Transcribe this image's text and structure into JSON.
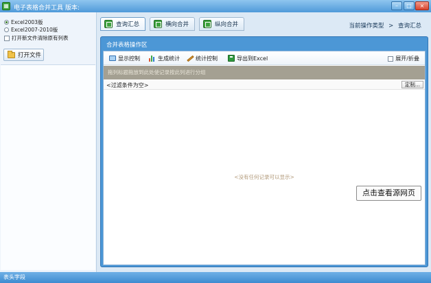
{
  "window": {
    "title": "电子表格合并工具  版本:",
    "minimize_label": "–",
    "maximize_label": "□",
    "close_label": "×"
  },
  "left_panel": {
    "radio_options": [
      {
        "label": "Excel2003版",
        "selected": true
      },
      {
        "label": "Excel2007-2010版",
        "selected": false
      }
    ],
    "clear_checkbox_label": "打开新文件清除原有列表",
    "open_file_label": "打开文件"
  },
  "tabs": [
    {
      "label": "查询汇总",
      "active": true
    },
    {
      "label": "横向合并",
      "active": false
    },
    {
      "label": "纵向合并",
      "active": false
    }
  ],
  "breadcrumb": {
    "prefix": "当前操作类型",
    "separator": ">",
    "current": "查询汇总"
  },
  "main": {
    "panel_title": "合并表格操作区",
    "toolbar": {
      "display_control": "显示控制",
      "generate_stats": "生成统计",
      "stats_control": "统计控制",
      "export_excel": "导出到Excel",
      "expand_collapse": "展开/折叠"
    },
    "group_hint": "拖列标题拖放到此处使记录按此列进行分组",
    "filter_text": "<过滤条件为空>",
    "custom_button": "定制...",
    "empty_message": "<没有任何记录可以显示>"
  },
  "overlay_button": "点击查看源网页",
  "status_bar": "表头字段",
  "colors": {
    "title_bar": "#4f9ad9",
    "panel_blue": "#4c97d6",
    "group_bar": "#a4a092",
    "status_bar": "#3d8bd0"
  }
}
